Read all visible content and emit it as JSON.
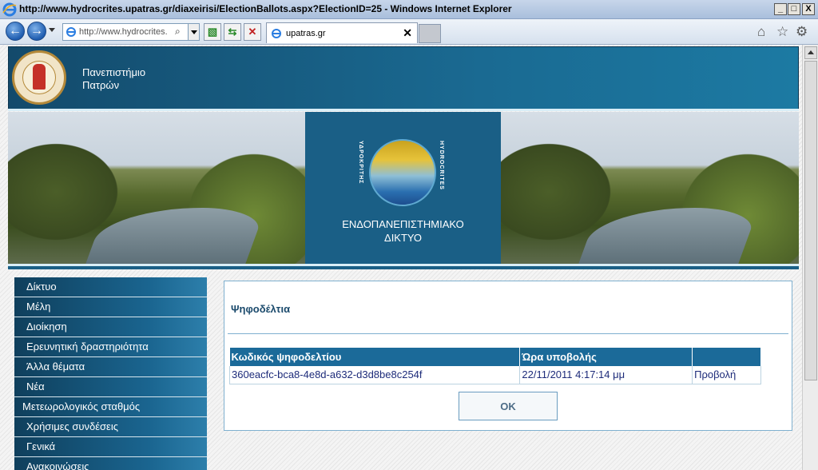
{
  "window": {
    "title": "http://www.hydrocrites.upatras.gr/diaxeirisi/ElectionBallots.aspx?ElectionID=25 - Windows Internet Explorer",
    "minimize": "_",
    "maximize": "□",
    "close": "X"
  },
  "toolbar": {
    "address": "http://www.hydrocrites.",
    "tab_label": "upatras.gr",
    "tab_close": "✕"
  },
  "header": {
    "university_line1": "Πανεπιστήμιο",
    "university_line2": "Πατρών"
  },
  "banner": {
    "caption_line1": "ΕΝΔΟΠΑΝΕΠΙΣΤΗΜΙΑΚΟ",
    "caption_line2": "ΔΙΚΤΥΟ",
    "emblem_left": "ΥΔΡΟΚΡΙΤΗΣ",
    "emblem_right": "HYDROCRITES"
  },
  "sidebar": {
    "items": [
      {
        "label": "Δίκτυο"
      },
      {
        "label": "Μέλη"
      },
      {
        "label": "Διοίκηση"
      },
      {
        "label": "Ερευνητική δραστηριότητα"
      },
      {
        "label": "Άλλα θέματα"
      },
      {
        "label": "Νέα"
      },
      {
        "label": "Μετεωρολογικός σταθμός"
      },
      {
        "label": "Χρήσιμες συνδέσεις"
      },
      {
        "label": "Γενικά"
      },
      {
        "label": "Ανακοινώσεις"
      }
    ]
  },
  "panel": {
    "title": "Ψηφοδέλτια",
    "table": {
      "headers": [
        "Κωδικός ψηφοδελτίου",
        "Ώρα υποβολής",
        ""
      ],
      "rows": [
        [
          "360eacfc-bca8-4e8d-a632-d3d8be8c254f",
          "22/11/2011 4:17:14 μμ",
          "Προβολή"
        ]
      ]
    },
    "ok_label": "OK"
  }
}
